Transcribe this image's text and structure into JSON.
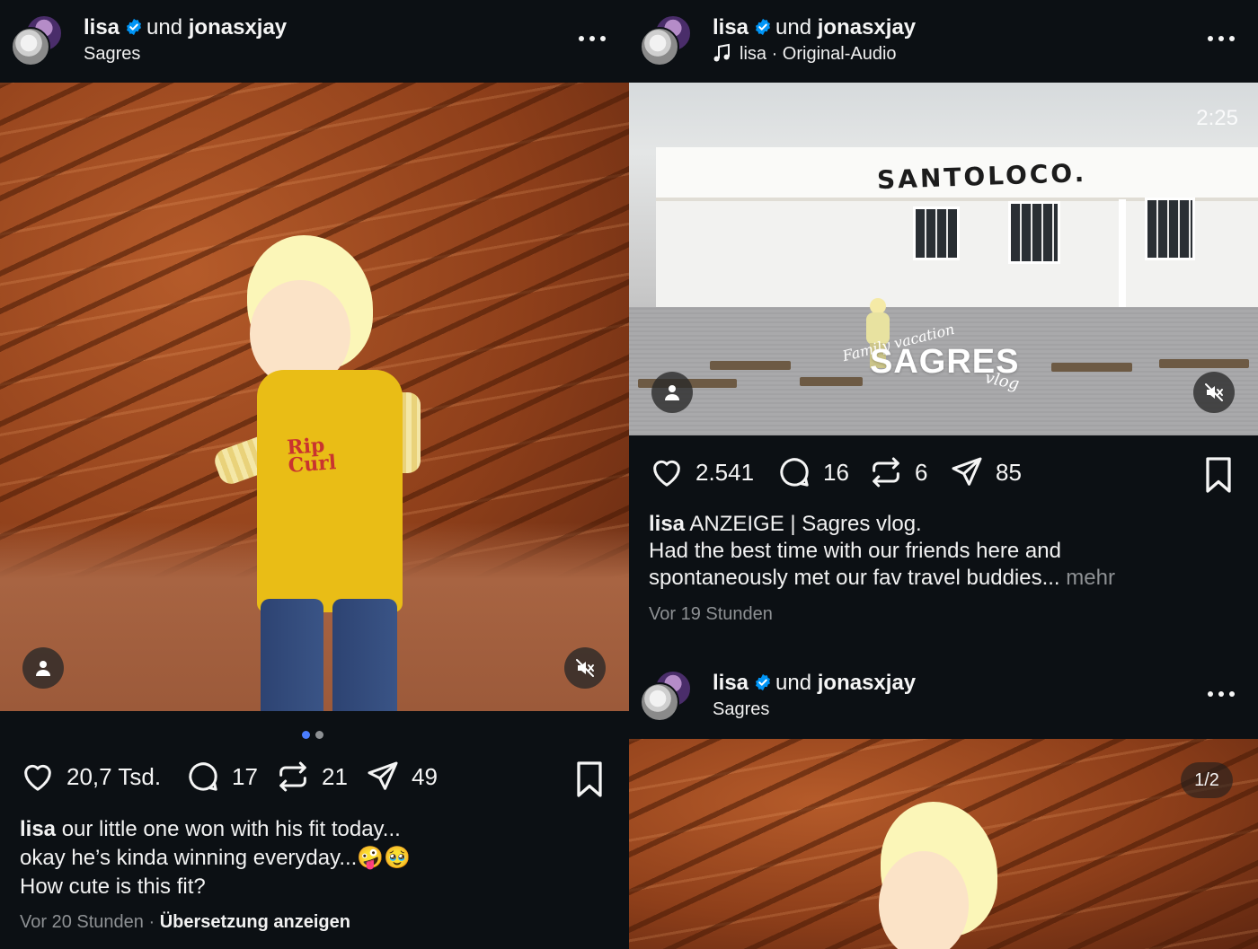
{
  "colors": {
    "background": "#0c1014",
    "text": "#f5f5f5",
    "muted": "#8e9194",
    "verified": "#0095f6",
    "dot_active": "#4a7dff",
    "dot_inactive": "#8e9194"
  },
  "left_post": {
    "author": "lisa",
    "connector": "und",
    "collaborator": "jonasxjay",
    "location": "Sagres",
    "actions": {
      "likes": "20,7 Tsd.",
      "comments": "17",
      "reposts": "21",
      "shares": "49"
    },
    "carousel": {
      "current": 1,
      "total": 2
    },
    "caption": {
      "username": "lisa",
      "line1": "our little one won with his fit today...",
      "line2": "okay he’s kinda winning everyday...🤪🥹",
      "line3": "How cute is this fit?"
    },
    "shirt_logo": [
      "Rip",
      "Curl"
    ],
    "timestamp": "Vor 20 Stunden",
    "separator": "·",
    "translate": "Übersetzung anzeigen"
  },
  "right_post": {
    "author": "lisa",
    "connector": "und",
    "collaborator": "jonasxjay",
    "audio": "lisa · Original-Audio",
    "video": {
      "duration": "2:25",
      "sign": "SANTOLOCO.",
      "overlay_family": "Family vacation",
      "overlay_title": "SAGRES",
      "overlay_vlog": "vlog"
    },
    "actions": {
      "likes": "2.541",
      "comments": "16",
      "reposts": "6",
      "shares": "85"
    },
    "caption": {
      "username": "lisa",
      "line1": "ANZEIGE | Sagres vlog.",
      "line2": "Had the best time with our friends here and",
      "line3": "spontaneously met our fav travel buddies...",
      "more": "mehr"
    },
    "timestamp": "Vor 19 Stunden"
  },
  "next_post": {
    "author": "lisa",
    "connector": "und",
    "collaborator": "jonasxjay",
    "location": "Sagres",
    "counter": "1/2"
  }
}
